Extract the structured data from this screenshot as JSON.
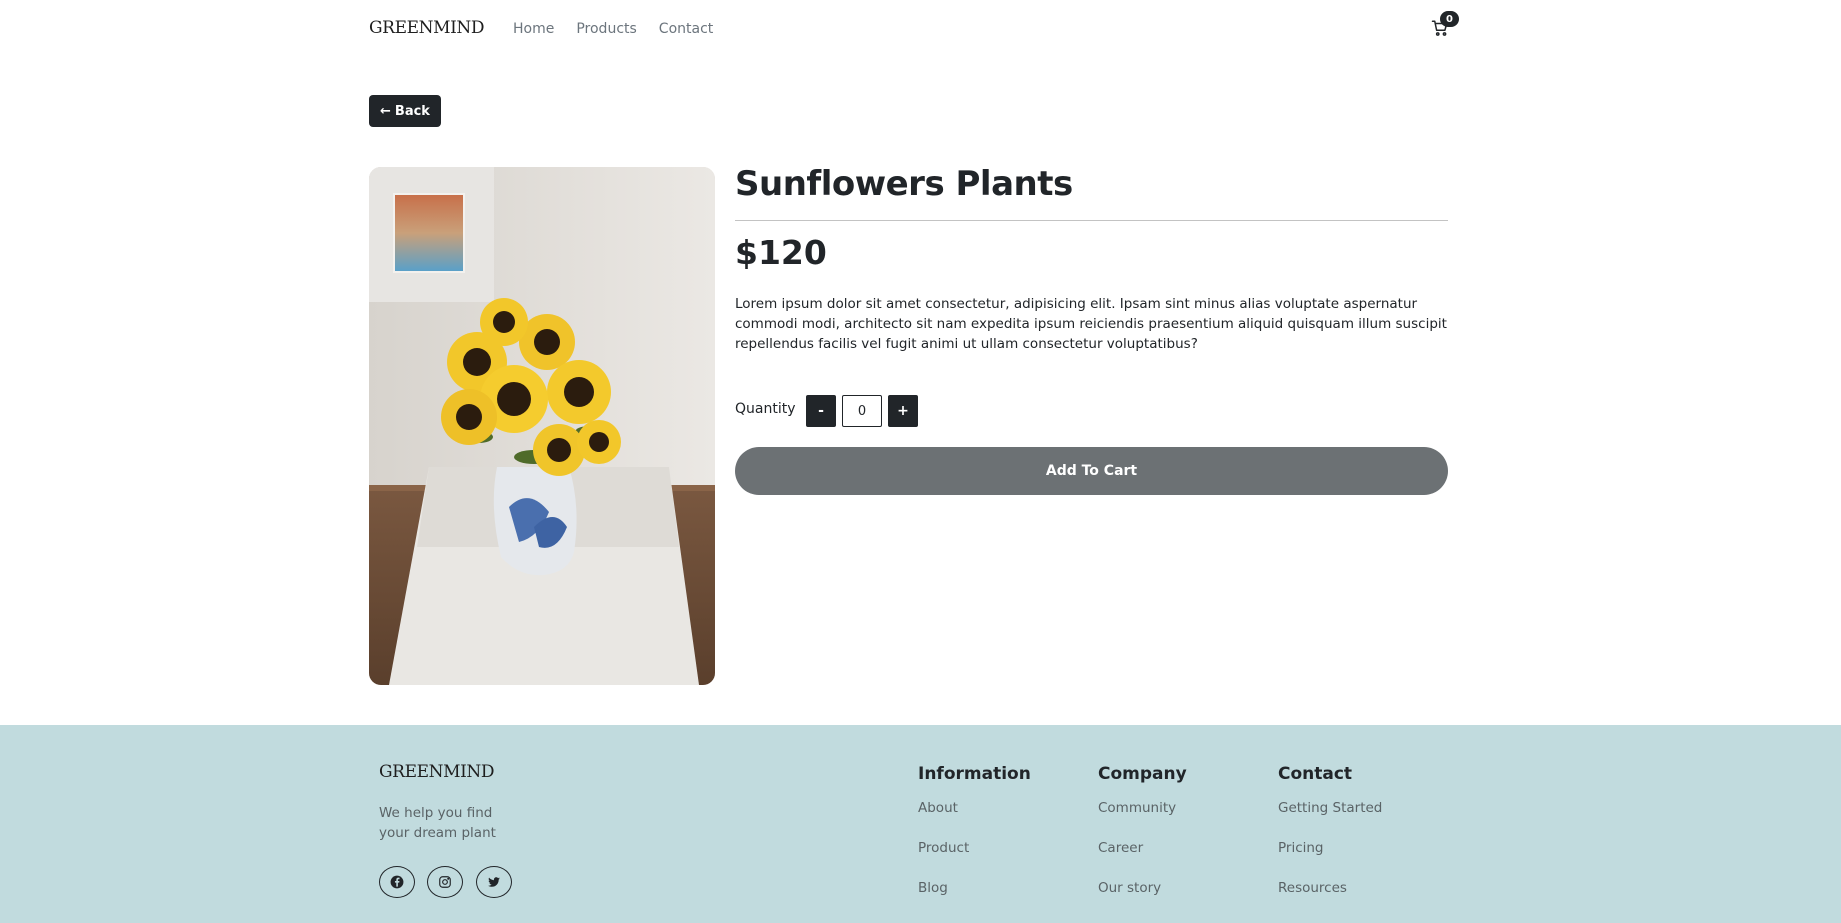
{
  "header": {
    "logo": "GREENMIND",
    "nav": [
      "Home",
      "Products",
      "Contact"
    ],
    "cart_count": "0"
  },
  "back_button": {
    "label": "Back"
  },
  "product": {
    "title": "Sunflowers Plants",
    "price": "$120",
    "description": "Lorem ipsum dolor sit amet consectetur, adipisicing elit. Ipsam sint minus alias voluptate aspernatur commodi modi, architecto sit nam expedita ipsum reiciendis praesentium aliquid quisquam illum suscipit repellendus facilis vel fugit animi ut ullam consectetur voluptatibus?",
    "quantity_label": "Quantity",
    "quantity_value": "0",
    "minus_label": "-",
    "plus_label": "+",
    "add_to_cart_label": "Add To Cart"
  },
  "footer": {
    "logo": "GREENMIND",
    "tagline": "We help you find your dream plant",
    "columns": [
      {
        "heading": "Information",
        "links": [
          "About",
          "Product",
          "Blog"
        ]
      },
      {
        "heading": "Company",
        "links": [
          "Community",
          "Career",
          "Our story"
        ]
      },
      {
        "heading": "Contact",
        "links": [
          "Getting Started",
          "Pricing",
          "Resources"
        ]
      }
    ],
    "social_icons": [
      "facebook-icon",
      "instagram-icon",
      "twitter-icon"
    ]
  },
  "colors": {
    "primary": "#212529",
    "add_button": "#6c7174",
    "footer_bg": "#c1dbde",
    "muted_text": "#6c757d"
  }
}
